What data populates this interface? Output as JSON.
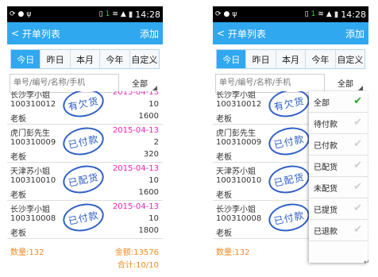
{
  "status": {
    "time": "14:28",
    "signal": "1"
  },
  "titlebar": {
    "back_label": "开单列表",
    "add_label": "添加"
  },
  "tabs": [
    {
      "label": "今日",
      "active": true
    },
    {
      "label": "昨日",
      "active": false
    },
    {
      "label": "本月",
      "active": false
    },
    {
      "label": "今年",
      "active": false
    },
    {
      "label": "自定义",
      "active": false
    }
  ],
  "search": {
    "placeholder": "单号/编号/名称/手机",
    "filter_label": "全部"
  },
  "orders": [
    {
      "name": "长沙李小姐",
      "code": "100310012",
      "role": "老板",
      "date": "2015-04-13",
      "qty": "10",
      "amount": "1600",
      "stamp": "有欠货"
    },
    {
      "name": "虎门彭先生",
      "code": "100310009",
      "role": "老板",
      "date": "2015-04-13",
      "qty": "2",
      "amount": "320",
      "stamp": "已付款"
    },
    {
      "name": "天津苏小姐",
      "code": "100310010",
      "role": "老板",
      "date": "2015-04-13",
      "qty": "10",
      "amount": "1600",
      "stamp": "已配货"
    },
    {
      "name": "长沙李小姐",
      "code": "100310008",
      "role": "老板",
      "date": "2015-04-13",
      "qty": "10",
      "amount": "1800",
      "stamp": "已付款"
    }
  ],
  "footer": {
    "count": "数量:132",
    "money": "金额:13576",
    "total": "合计:10/10"
  },
  "dropdown": [
    {
      "label": "全部",
      "selected": true
    },
    {
      "label": "待付款",
      "selected": false
    },
    {
      "label": "已付款",
      "selected": false
    },
    {
      "label": "已配货",
      "selected": false
    },
    {
      "label": "未配货",
      "selected": false
    },
    {
      "label": "已提货",
      "selected": false
    },
    {
      "label": "已退款",
      "selected": false
    }
  ],
  "colors": {
    "accent": "#30a8ef",
    "date": "#ee22b2",
    "footer": "#f08a24",
    "stamp": "#2c5cc4",
    "check": "#22aa22"
  }
}
